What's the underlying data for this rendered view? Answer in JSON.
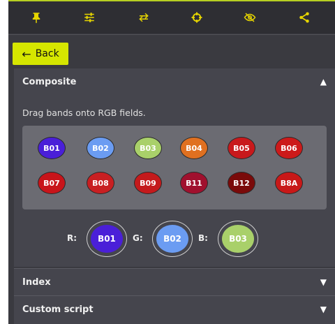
{
  "toolbar": {
    "icons": [
      "pin-icon",
      "sliders-icon",
      "swap-icon",
      "crosshair-icon",
      "eye-off-icon",
      "share-icon"
    ],
    "accent": "#e6d500"
  },
  "back": {
    "label": "Back"
  },
  "composite": {
    "title": "Composite",
    "hint": "Drag bands onto RGB fields.",
    "bands": [
      {
        "label": "B01",
        "color": "#4a1fd8"
      },
      {
        "label": "B02",
        "color": "#6b9cf2"
      },
      {
        "label": "B03",
        "color": "#a9d06a"
      },
      {
        "label": "B04",
        "color": "#e07020"
      },
      {
        "label": "B05",
        "color": "#c8191c"
      },
      {
        "label": "B06",
        "color": "#cc1a1a"
      },
      {
        "label": "B07",
        "color": "#c8141a"
      },
      {
        "label": "B08",
        "color": "#c81f22"
      },
      {
        "label": "B09",
        "color": "#c41a1c"
      },
      {
        "label": "B11",
        "color": "#a0102e"
      },
      {
        "label": "B12",
        "color": "#7a0a0a"
      },
      {
        "label": "B8A",
        "color": "#c81818"
      }
    ],
    "rgb": {
      "r_label": "R:",
      "g_label": "G:",
      "b_label": "B:",
      "r": {
        "label": "B01",
        "color": "#4a1fd8"
      },
      "g": {
        "label": "B02",
        "color": "#6b9cf2"
      },
      "b": {
        "label": "B03",
        "color": "#a9d06a"
      }
    }
  },
  "index": {
    "title": "Index"
  },
  "custom_script": {
    "title": "Custom script"
  }
}
